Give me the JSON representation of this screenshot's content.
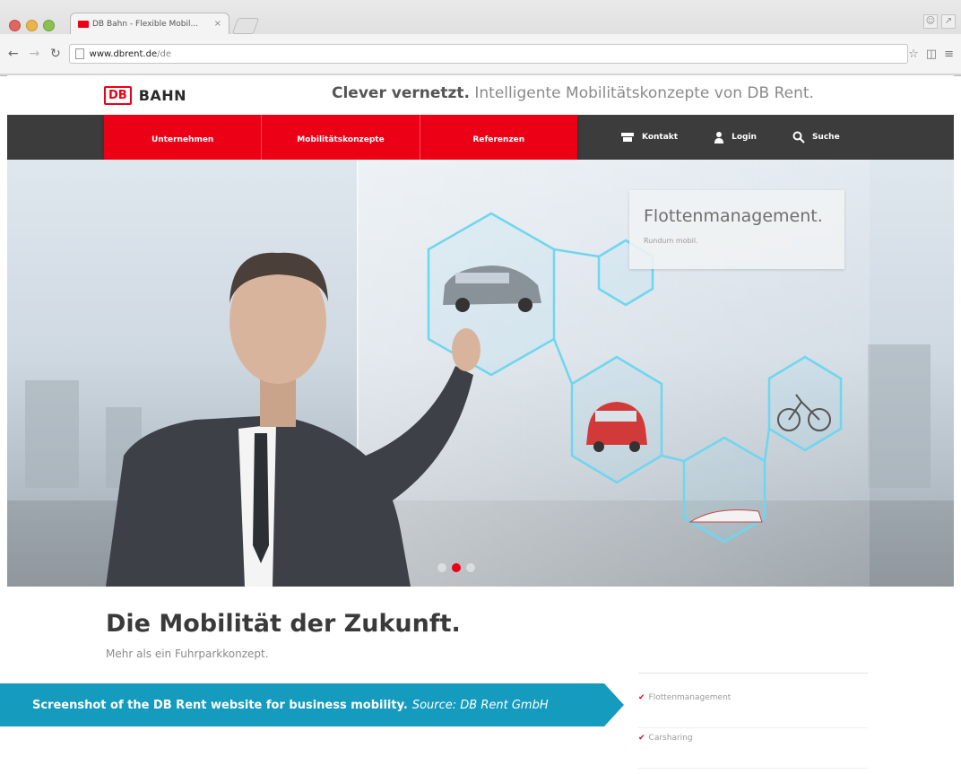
{
  "browser": {
    "tab_title": "DB Bahn - Flexible Mobil...",
    "tab_close": "×",
    "url_host": "www.dbrent.de",
    "url_path": "/de"
  },
  "site": {
    "logo_box": "DB",
    "logo_word": "BAHN",
    "claim_bold": "Clever vernetzt.",
    "claim_rest": " Intelligente Mobilitätskonzepte von DB Rent."
  },
  "nav": {
    "items": [
      "Unternehmen",
      "Mobilitätskonzepte",
      "Referenzen"
    ],
    "contact": "Kontakt",
    "login": "Login",
    "search": "Suche"
  },
  "hero": {
    "feature_title": "Flottenmanagement.",
    "feature_sub": "Rundum mobil.",
    "slide_count": 3,
    "active_slide": 1
  },
  "content": {
    "headline": "Die Mobilität der Zukunft.",
    "subline": "Mehr als ein Fuhrparkkonzept.",
    "list": [
      "Flottenmanagement",
      "Carsharing"
    ]
  },
  "caption": {
    "main": "Screenshot of the DB Rent website for business mobility.",
    "source": "Source: DB Rent GmbH"
  },
  "colors": {
    "brand_red": "#ec0016",
    "nav_dark": "#3c3c3c",
    "caption_blue": "#159bbd"
  }
}
